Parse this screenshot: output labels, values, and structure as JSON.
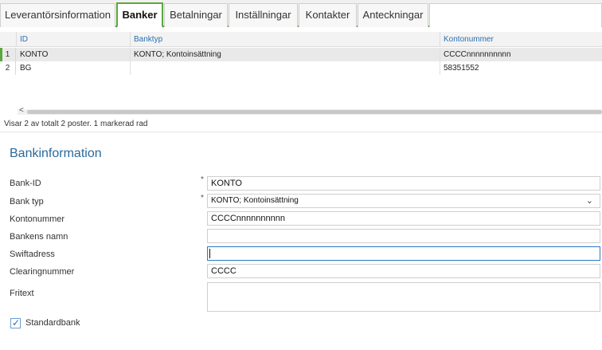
{
  "tabs": [
    {
      "label": "Leverantörsinformation"
    },
    {
      "label": "Banker"
    },
    {
      "label": "Betalningar"
    },
    {
      "label": "Inställningar"
    },
    {
      "label": "Kontakter"
    },
    {
      "label": "Anteckningar"
    }
  ],
  "grid": {
    "headers": {
      "id": "ID",
      "banktyp": "Banktyp",
      "kontonummer": "Kontonummer"
    },
    "rows": [
      {
        "num": "1",
        "id": "KONTO",
        "banktyp": "KONTO; Kontoinsättning",
        "kontonummer": "CCCCnnnnnnnnnn"
      },
      {
        "num": "2",
        "id": "BG",
        "banktyp": "",
        "kontonummer": "58351552"
      }
    ],
    "scroll_left": "<"
  },
  "status_text": "Visar 2 av totalt 2 poster. 1 markerad rad",
  "form": {
    "title": "Bankinformation",
    "labels": {
      "bank_id": "Bank-ID",
      "bank_typ": "Bank typ",
      "kontonummer": "Kontonummer",
      "bankens_namn": "Bankens namn",
      "swiftadress": "Swiftadress",
      "clearingnummer": "Clearingnummer",
      "fritext": "Fritext"
    },
    "required_mark": "*",
    "values": {
      "bank_id": "KONTO",
      "bank_typ": "KONTO; Kontoinsättning",
      "kontonummer": "CCCCnnnnnnnnnn",
      "bankens_namn": "",
      "swiftadress": "",
      "clearingnummer": "CCCC",
      "fritext": ""
    },
    "dropdown_arrow": "⌄",
    "standardbank": {
      "label": "Standardbank",
      "checked": true,
      "mark": "✓"
    }
  },
  "colors": {
    "accent_green": "#5aa83c",
    "header_blue": "#2a6fb0",
    "title_blue": "#2a6a9a",
    "focus_blue": "#2b7bbf"
  }
}
